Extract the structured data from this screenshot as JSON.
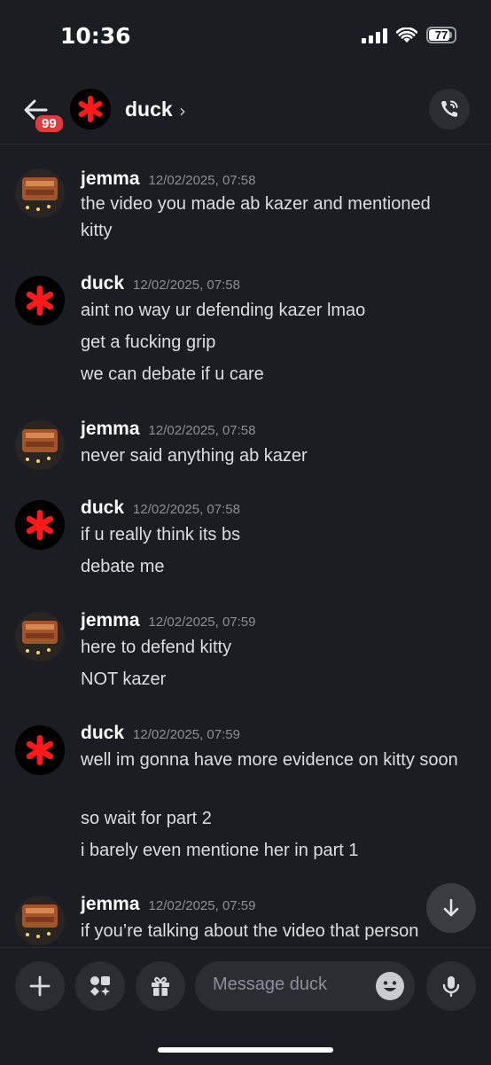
{
  "status_bar": {
    "time": "10:36",
    "battery": "77"
  },
  "header": {
    "unread_badge": "99",
    "title": "duck",
    "chevron": "›"
  },
  "messages": [
    {
      "author": "jemma",
      "timestamp": "12/02/2025, 07:58",
      "lines": [
        "the video you made ab kazer and mentioned kitty"
      ]
    },
    {
      "author": "duck",
      "timestamp": "12/02/2025, 07:58",
      "lines": [
        "aint no way ur defending kazer lmao",
        "get a fucking grip",
        "we can debate if u care"
      ]
    },
    {
      "author": "jemma",
      "timestamp": "12/02/2025, 07:58",
      "lines": [
        "never said anything ab kazer"
      ]
    },
    {
      "author": "duck",
      "timestamp": "12/02/2025, 07:58",
      "lines": [
        "if u really think its bs",
        "debate me"
      ]
    },
    {
      "author": "jemma",
      "timestamp": "12/02/2025, 07:59",
      "lines": [
        "here to defend kitty",
        "NOT kazer"
      ]
    },
    {
      "author": "duck",
      "timestamp": "12/02/2025, 07:59",
      "lines": [
        "well im gonna have more evidence on kitty soon",
        "so wait for part 2",
        "i barely even mentione her in part 1"
      ]
    },
    {
      "author": "jemma",
      "timestamp": "12/02/2025, 07:59",
      "lines": [
        "if you’re talking about the video that person"
      ]
    }
  ],
  "composer": {
    "placeholder": "Message duck"
  },
  "icons": {
    "back": "arrow-left-icon",
    "call": "phone-call-icon",
    "add": "plus-icon",
    "apps": "apps-icon",
    "gift": "gift-icon",
    "emoji": "emoji-icon",
    "mic": "microphone-icon",
    "scroll": "arrow-down-icon"
  },
  "colors": {
    "background": "#1c1d22",
    "badge": "#e03a3e",
    "duck_avatar_star": "#ff1a1a"
  }
}
